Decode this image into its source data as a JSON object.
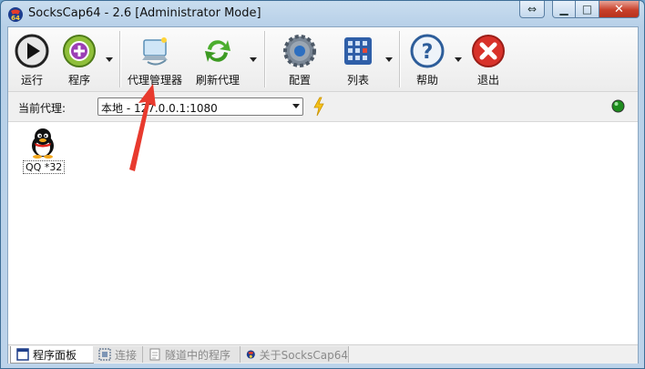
{
  "window": {
    "title": "SocksCap64 - 2.6 [Administrator Mode]",
    "accent": "#c8402a",
    "controls": {
      "restore": "⇔",
      "minimize": "▁",
      "maximize": "□",
      "close": "✕"
    }
  },
  "toolbar": {
    "run": "运行",
    "programs": "程序",
    "proxy_manager": "代理管理器",
    "refresh_proxy": "刷新代理",
    "config": "配置",
    "list": "列表",
    "help": "帮助",
    "exit": "退出"
  },
  "proxy": {
    "label": "当前代理:",
    "selected": "本地 - 127.0.0.1:1080",
    "status_color": "#1e8c1e"
  },
  "apps": [
    {
      "label": "QQ *32",
      "icon": "qq-penguin-icon"
    }
  ],
  "tabs": [
    {
      "label": "程序面板",
      "active": true
    },
    {
      "label": "连接",
      "active": false
    },
    {
      "label": "隧道中的程序",
      "active": false
    },
    {
      "label": "关于SocksCap64",
      "active": false
    }
  ],
  "annotation": {
    "color": "#e83a2e"
  }
}
